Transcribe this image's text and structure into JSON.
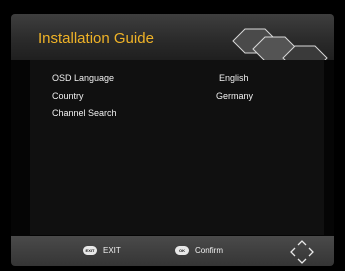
{
  "header": {
    "title": "Installation Guide"
  },
  "settings": [
    {
      "label": "OSD Language",
      "value": "English"
    },
    {
      "label": "Country",
      "value": "Germany"
    },
    {
      "label": "Channel Search",
      "value": ""
    }
  ],
  "footer": {
    "exit": {
      "key": "EXIT",
      "label": "EXIT"
    },
    "confirm": {
      "key": "OK",
      "label": "Confirm"
    }
  },
  "colors": {
    "title": "#f0b327",
    "accent": "#c8a020"
  },
  "icons": [
    "hexagon-decoration-icon",
    "navigation-arrows-icon"
  ]
}
